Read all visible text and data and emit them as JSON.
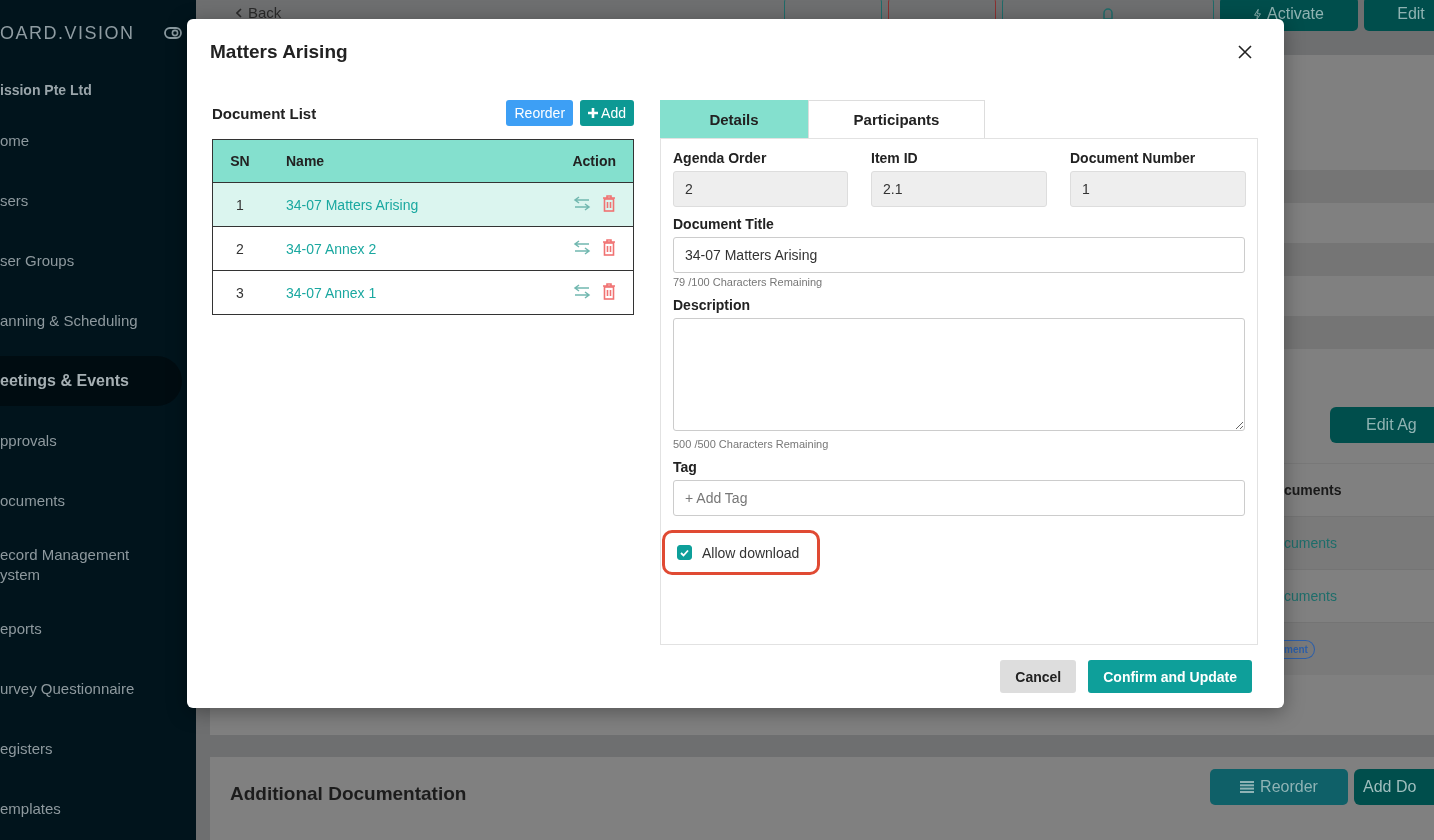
{
  "sidebar": {
    "brand": "OARD.VISION",
    "organization": "ission Pte Ltd",
    "items": [
      {
        "label": "ome",
        "selected": false
      },
      {
        "label": "sers",
        "selected": false
      },
      {
        "label": "ser Groups",
        "selected": false
      },
      {
        "label": "anning & Scheduling",
        "selected": false
      },
      {
        "label": "eetings & Events",
        "selected": true
      },
      {
        "label": "pprovals",
        "selected": false
      },
      {
        "label": "ocuments",
        "selected": false
      },
      {
        "label": "ecord Management ystem",
        "selected": false
      },
      {
        "label": "eports",
        "selected": false
      },
      {
        "label": "urvey Questionnaire",
        "selected": false
      },
      {
        "label": "egisters",
        "selected": false
      },
      {
        "label": "emplates",
        "selected": false
      }
    ]
  },
  "page": {
    "back_link": "Back",
    "actions": [
      {
        "kind": "outline"
      },
      {
        "kind": "danger"
      },
      {
        "kind": "notify"
      },
      {
        "label": "Activate",
        "kind": "activate"
      },
      {
        "label": "Edit",
        "kind": "edit"
      }
    ],
    "agenda": {
      "edit_button": "Edit Ag",
      "column_header": "cuments",
      "rows": [
        {
          "kind": "link",
          "text": "cuments"
        },
        {
          "kind": "link",
          "text": "cuments"
        },
        {
          "kind": "badge",
          "text": "ment"
        }
      ]
    },
    "additional": {
      "title": "Additional Documentation",
      "buttons": [
        {
          "label": "Reorder",
          "kind": "reorder"
        },
        {
          "label": "Add Do",
          "kind": "add"
        }
      ]
    }
  },
  "modal": {
    "title": "Matters Arising",
    "document_list": {
      "title": "Document List",
      "buttons": [
        {
          "label": "Reorder",
          "kind": "reorder"
        },
        {
          "label": "Add",
          "kind": "add"
        }
      ],
      "columns": [
        "SN",
        "Name",
        "Action"
      ],
      "rows": [
        {
          "sn": "1",
          "name": "34-07 Matters Arising",
          "selected": true
        },
        {
          "sn": "2",
          "name": "34-07 Annex 2",
          "selected": false
        },
        {
          "sn": "3",
          "name": "34-07 Annex 1",
          "selected": false
        }
      ]
    },
    "tabs": [
      {
        "label": "Details",
        "selected": true
      },
      {
        "label": "Participants",
        "selected": false
      }
    ],
    "info_fields": [
      {
        "label": "Agenda Order",
        "value": "2",
        "disabled": true
      },
      {
        "label": "Item ID",
        "value": "2.1",
        "disabled": true
      },
      {
        "label": "Document Number",
        "value": "1",
        "disabled": true
      }
    ],
    "fields": [
      {
        "kind": "input",
        "label": "Document Title",
        "value": "34-07 Matters Arising",
        "counter": "79 /100 Characters Remaining"
      },
      {
        "kind": "textarea",
        "label": "Description",
        "counter": "500 /500 Characters Remaining"
      },
      {
        "kind": "tag",
        "label": "Tag",
        "placeholder": "+ Add Tag"
      }
    ],
    "checkbox": {
      "label": "Allow download",
      "checked": true,
      "highlighted": true
    },
    "footer": [
      {
        "label": "Cancel",
        "kind": "secondary"
      },
      {
        "label": "Confirm and Update",
        "kind": "primary"
      }
    ]
  }
}
